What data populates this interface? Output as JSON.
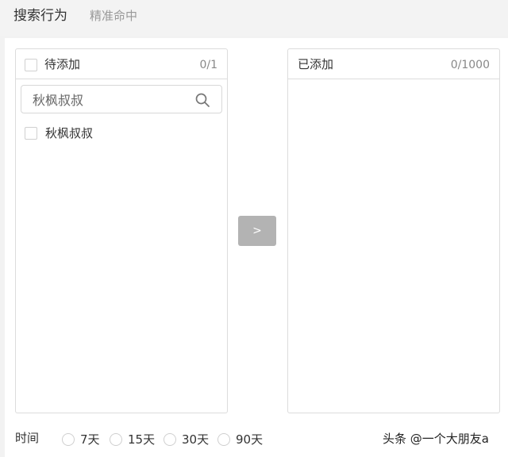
{
  "header": {
    "title": "搜索行为",
    "subtitle": "精准命中"
  },
  "pending": {
    "label": "待添加",
    "count": "0/1",
    "search": {
      "value": "秋枫叔叔",
      "icon": "search-icon"
    },
    "items": [
      {
        "label": "秋枫叔叔"
      }
    ]
  },
  "added": {
    "label": "已添加",
    "count": "0/1000"
  },
  "transfer": {
    "label": ">",
    "color": "#b3b3b3"
  },
  "time": {
    "label": "时间",
    "options": [
      {
        "label": "7天"
      },
      {
        "label": "15天"
      },
      {
        "label": "30天"
      },
      {
        "label": "90天"
      }
    ]
  },
  "watermark": "头条 @一个大朋友a"
}
